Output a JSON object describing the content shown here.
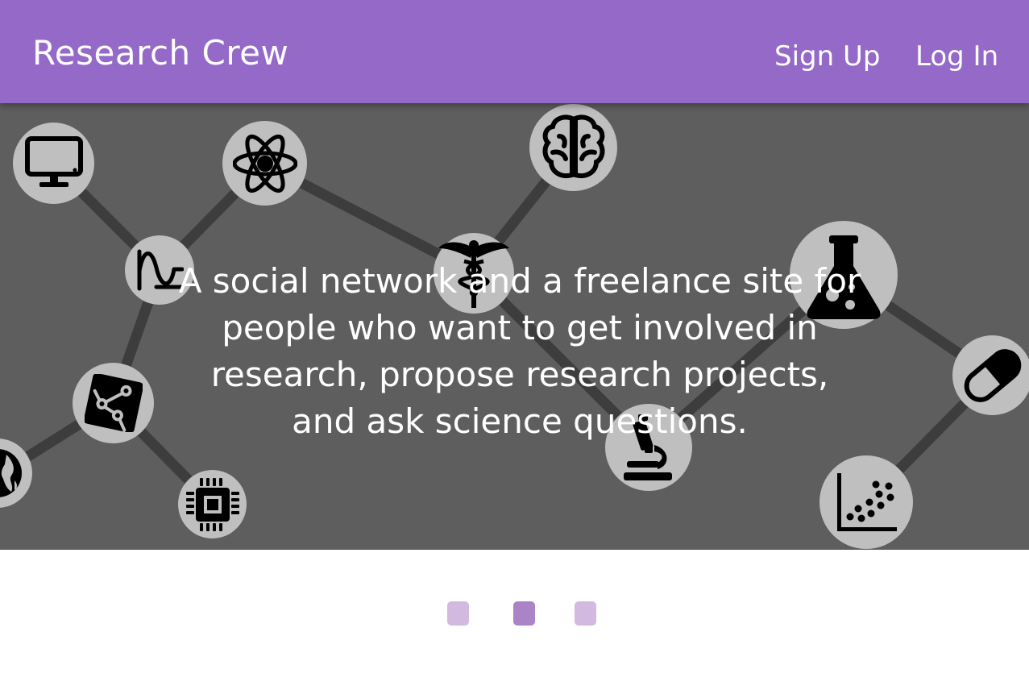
{
  "header": {
    "brand": "Research Crew",
    "nav": {
      "signup_label": "Sign Up",
      "login_label": "Log In"
    },
    "color": "#9469c8"
  },
  "hero": {
    "tagline": "A social network and a freelance site for people who want to get involved in research, propose research projects, and ask science questions.",
    "background_color": "#5e5e5e",
    "node_icons": [
      "monitor-icon",
      "atom-icon",
      "brain-icon",
      "sine-wave-icon",
      "caduceus-icon",
      "flask-icon",
      "circuit-board-icon",
      "pill-icon",
      "globe-icon",
      "microscope-icon",
      "cpu-chip-icon",
      "scatter-plot-icon"
    ]
  },
  "carousel": {
    "slide_count": 3,
    "active_index": 1,
    "active_color": "#a985c7",
    "inactive_color": "#d2b9e0"
  }
}
